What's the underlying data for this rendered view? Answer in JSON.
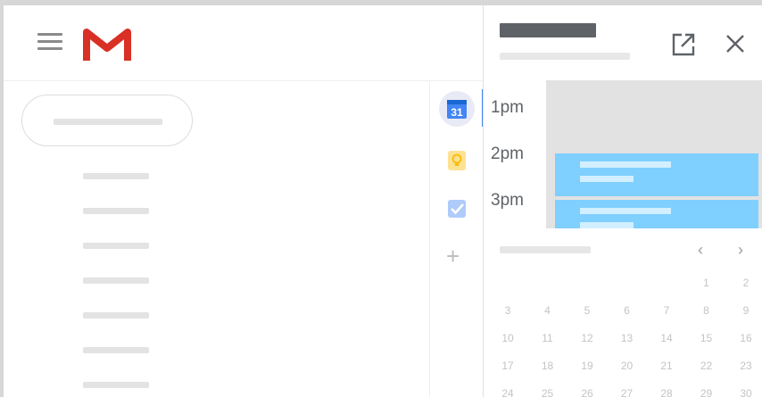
{
  "calendar": {
    "times": [
      "1pm",
      "2pm",
      "3pm"
    ],
    "days": [
      [
        "",
        "",
        "",
        "",
        "",
        "1",
        "2"
      ],
      [
        "3",
        "4",
        "5",
        "6",
        "7",
        "8",
        "9"
      ],
      [
        "10",
        "11",
        "12",
        "13",
        "14",
        "15",
        "16"
      ],
      [
        "17",
        "18",
        "19",
        "20",
        "21",
        "22",
        "23"
      ],
      [
        "24",
        "25",
        "26",
        "27",
        "28",
        "29",
        "30"
      ]
    ],
    "nav_prev": "‹",
    "nav_next": "›"
  },
  "rail": {
    "calendar_icon_number": "31",
    "add_label": "+"
  },
  "colors": {
    "gmail_red": "#d93025",
    "calendar_blue": "#4285f4",
    "keep_yellow": "#f6bf26",
    "tasks_blue": "#4285f4",
    "event_blue": "#7fcfff"
  },
  "icons": [
    "menu-icon",
    "gmail-logo",
    "calendar-icon",
    "keep-icon",
    "tasks-icon",
    "add-icon",
    "open-in-new-icon",
    "close-icon",
    "chevron-left-icon",
    "chevron-right-icon"
  ]
}
